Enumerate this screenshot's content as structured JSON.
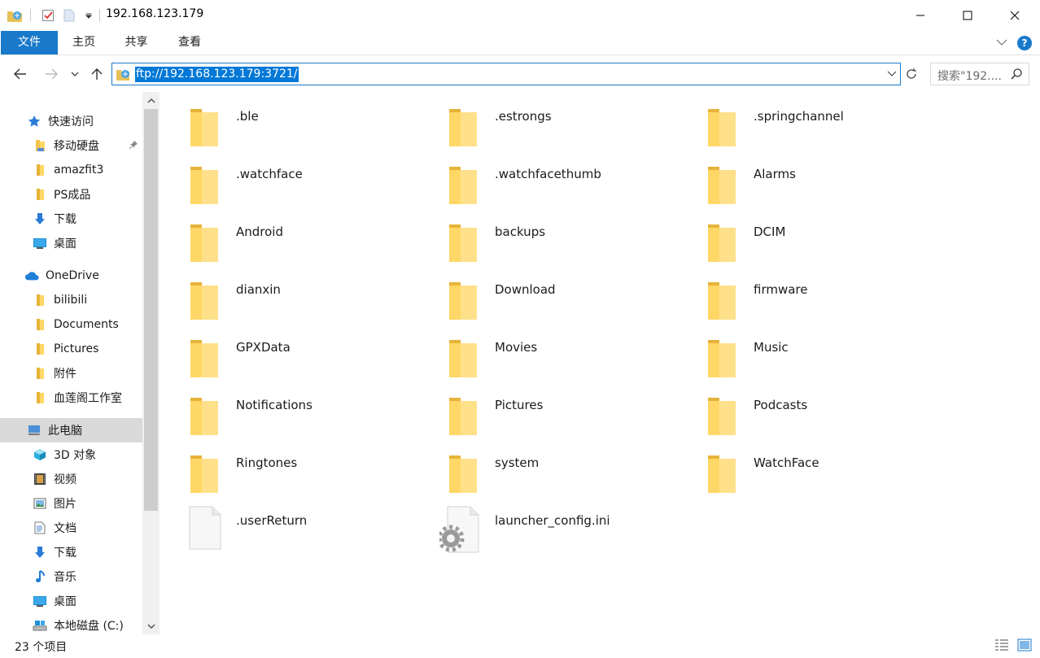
{
  "window": {
    "title": "192.168.123.179"
  },
  "ribbon": {
    "tabs": [
      {
        "label": "文件"
      },
      {
        "label": "主页"
      },
      {
        "label": "共享"
      },
      {
        "label": "查看"
      }
    ]
  },
  "address": {
    "path": "ftp://192.168.123.179:3721/",
    "search_placeholder": "搜索\"192...."
  },
  "sidebar": {
    "items": [
      {
        "label": "快速访问",
        "icon": "star-icon"
      },
      {
        "label": "移动硬盘",
        "icon": "folder-icon",
        "pinned": true
      },
      {
        "label": "amazfit3",
        "icon": "folder-icon"
      },
      {
        "label": "PS成品",
        "icon": "folder-icon"
      },
      {
        "label": "下载",
        "icon": "download-icon"
      },
      {
        "label": "桌面",
        "icon": "desktop-icon"
      },
      {
        "label": "OneDrive",
        "icon": "cloud-icon"
      },
      {
        "label": "bilibili",
        "icon": "folder-icon"
      },
      {
        "label": "Documents",
        "icon": "folder-icon"
      },
      {
        "label": "Pictures",
        "icon": "folder-icon"
      },
      {
        "label": "附件",
        "icon": "folder-icon"
      },
      {
        "label": "血莲阁工作室",
        "icon": "folder-icon"
      },
      {
        "label": "此电脑",
        "icon": "computer-icon",
        "selected": true
      },
      {
        "label": "3D 对象",
        "icon": "cube-icon"
      },
      {
        "label": "视频",
        "icon": "video-icon"
      },
      {
        "label": "图片",
        "icon": "picture-icon"
      },
      {
        "label": "文档",
        "icon": "document-icon"
      },
      {
        "label": "下载",
        "icon": "download-icon"
      },
      {
        "label": "音乐",
        "icon": "music-icon"
      },
      {
        "label": "桌面",
        "icon": "desktop-icon"
      },
      {
        "label": "本地磁盘 (C:)",
        "icon": "drive-icon"
      }
    ]
  },
  "files": [
    {
      "name": ".ble",
      "type": "folder"
    },
    {
      "name": ".estrongs",
      "type": "folder"
    },
    {
      "name": ".springchannel",
      "type": "folder"
    },
    {
      "name": ".watchface",
      "type": "folder"
    },
    {
      "name": ".watchfacethumb",
      "type": "folder"
    },
    {
      "name": "Alarms",
      "type": "folder"
    },
    {
      "name": "Android",
      "type": "folder"
    },
    {
      "name": "backups",
      "type": "folder"
    },
    {
      "name": "DCIM",
      "type": "folder"
    },
    {
      "name": "dianxin",
      "type": "folder"
    },
    {
      "name": "Download",
      "type": "folder"
    },
    {
      "name": "firmware",
      "type": "folder"
    },
    {
      "name": "GPXData",
      "type": "folder"
    },
    {
      "name": "Movies",
      "type": "folder"
    },
    {
      "name": "Music",
      "type": "folder"
    },
    {
      "name": "Notifications",
      "type": "folder"
    },
    {
      "name": "Pictures",
      "type": "folder"
    },
    {
      "name": "Podcasts",
      "type": "folder"
    },
    {
      "name": "Ringtones",
      "type": "folder"
    },
    {
      "name": "system",
      "type": "folder"
    },
    {
      "name": "WatchFace",
      "type": "folder"
    },
    {
      "name": ".userReturn",
      "type": "file"
    },
    {
      "name": "launcher_config.ini",
      "type": "config"
    }
  ],
  "status": {
    "count_text": "23 个项目"
  },
  "colors": {
    "accent": "#1979ca",
    "selection": "#0078d7",
    "folder": "#ffd766"
  }
}
